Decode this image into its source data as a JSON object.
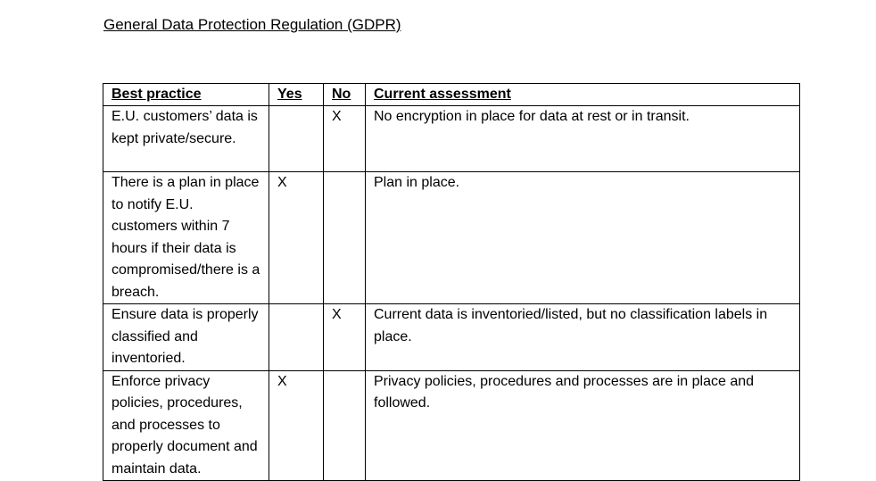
{
  "document": {
    "title": "General Data Protection Regulation (GDPR)"
  },
  "table": {
    "headers": {
      "best_practice": "Best practice",
      "yes": "Yes",
      "no": "No",
      "current_assessment": "Current assessment"
    },
    "rows": [
      {
        "best_practice": "E.U. customers’ data is kept private/secure.",
        "yes": "",
        "no": "X",
        "current_assessment": "No encryption in place for data at rest or in transit."
      },
      {
        "best_practice": "There is a plan in place to notify E.U. customers within 7 hours if their data is compromised/there is a breach.",
        "yes": "X",
        "no": "",
        "current_assessment": "Plan in place."
      },
      {
        "best_practice": "Ensure data is properly classified and inventoried.",
        "yes": "",
        "no": "X",
        "current_assessment": "Current data is inventoried/listed, but no classification labels in place."
      },
      {
        "best_practice": "Enforce privacy policies, procedures, and processes to properly document and maintain data.",
        "yes": "X",
        "no": "",
        "current_assessment": "Privacy policies, procedures and processes are in place and followed."
      }
    ]
  }
}
